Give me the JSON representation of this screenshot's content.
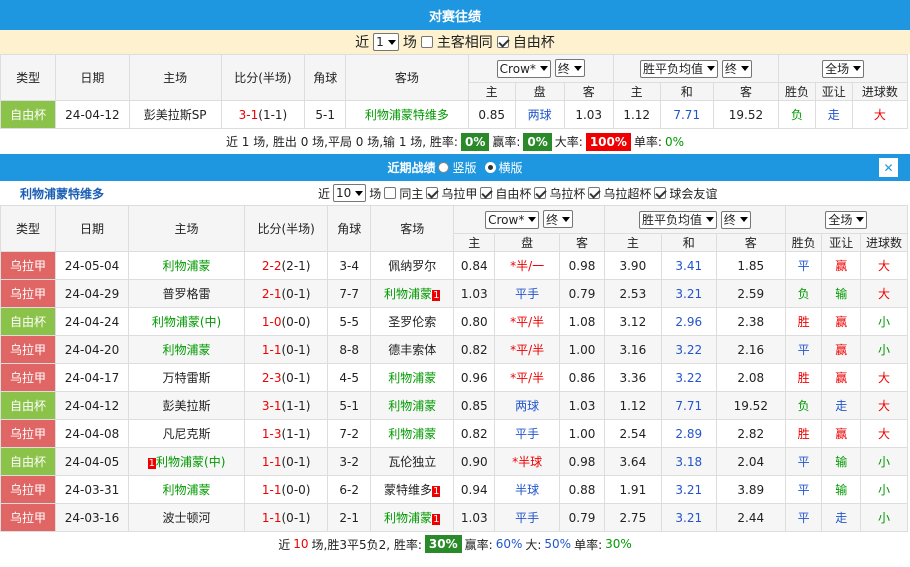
{
  "h2h": {
    "title": "对赛往绩",
    "near_label": "近",
    "count_value": "1",
    "unit": "场",
    "same_home": "主客相同",
    "cup_label": "自由杯",
    "headers": [
      "类型",
      "日期",
      "主场",
      "比分(半场)",
      "角球",
      "客场"
    ],
    "crow": "Crow*",
    "end": "终",
    "odds_avg": "胜平负均值",
    "full": "全场",
    "sub_headers": [
      "主",
      "盘",
      "客",
      "主",
      "和",
      "客"
    ],
    "right_headers": [
      "胜负",
      "亚让",
      "进球数"
    ],
    "rows": [
      {
        "type": "自由杯",
        "type_color": "#8bc34a",
        "date": "24-04-12",
        "home": "彭美拉斯SP",
        "score": "3-1",
        "half": "(1-1)",
        "corner": "5-1",
        "away": "利物浦蒙特维多",
        "o1": "0.85",
        "o2": "两球",
        "o3": "1.03",
        "e1": "1.12",
        "e2": "7.71",
        "e3": "19.52",
        "r1": "负",
        "r2": "走",
        "r3": "大"
      }
    ],
    "summary": {
      "text": "近 1 场, 胜出 0 场,平局 0 场,输 1 场, 胜率:",
      "win": "0%",
      "win_label": "赢率:",
      "win_rate": "0%",
      "big_label": "大率:",
      "big_rate": "100%",
      "single_label": "单率:",
      "single_rate": "0%"
    }
  },
  "recent": {
    "title": "近期战绩",
    "vert": "竖版",
    "horiz": "横版",
    "close": "✕",
    "team": "利物浦蒙特维多",
    "near_label": "近",
    "count_value": "10",
    "unit": "场",
    "filters": [
      "同主",
      "乌拉甲",
      "自由杯",
      "乌拉杯",
      "乌拉超杯",
      "球会友谊"
    ],
    "headers": [
      "类型",
      "日期",
      "主场",
      "比分(半场)",
      "角球",
      "客场"
    ],
    "crow": "Crow*",
    "end": "终",
    "odds_avg": "胜平负均值",
    "full": "全场",
    "sub_headers": [
      "主",
      "盘",
      "客",
      "主",
      "和",
      "客"
    ],
    "right_headers": [
      "胜负",
      "亚让",
      "进球数"
    ],
    "rows": [
      {
        "type": "乌拉甲",
        "c": "#e06666",
        "date": "24-05-04",
        "home": "利物浦蒙",
        "hg": true,
        "score": "2-2",
        "half": "(2-1)",
        "corner": "3-4",
        "away": "佩纳罗尔",
        "ag": false,
        "o1": "0.84",
        "o2": "*半/一",
        "o2r": true,
        "o3": "0.98",
        "e1": "3.90",
        "e2": "3.41",
        "e3": "1.85",
        "r1": "平",
        "r1c": "blue",
        "r2": "赢",
        "r2c": "red",
        "r3": "大",
        "r3c": "red"
      },
      {
        "type": "乌拉甲",
        "c": "#e06666",
        "date": "24-04-29",
        "home": "普罗格雷",
        "hg": false,
        "score": "2-1",
        "half": "(0-1)",
        "corner": "7-7",
        "away": "利物浦蒙",
        "ag": true,
        "aflag": "1",
        "o1": "1.03",
        "o2": "平手",
        "o2r": false,
        "o3": "0.79",
        "e1": "2.53",
        "e2": "3.21",
        "e3": "2.59",
        "r1": "负",
        "r1c": "green",
        "r2": "输",
        "r2c": "green",
        "r3": "大",
        "r3c": "red"
      },
      {
        "type": "自由杯",
        "c": "#8bc34a",
        "date": "24-04-24",
        "home": "利物浦蒙(中)",
        "hg": true,
        "score": "1-0",
        "half": "(0-0)",
        "corner": "5-5",
        "away": "圣罗伦索",
        "ag": false,
        "o1": "0.80",
        "o2": "*平/半",
        "o2r": true,
        "o3": "1.08",
        "e1": "3.12",
        "e2": "2.96",
        "e3": "2.38",
        "r1": "胜",
        "r1c": "red",
        "r2": "赢",
        "r2c": "red",
        "r3": "小",
        "r3c": "green"
      },
      {
        "type": "乌拉甲",
        "c": "#e06666",
        "date": "24-04-20",
        "home": "利物浦蒙",
        "hg": true,
        "score": "1-1",
        "half": "(0-1)",
        "corner": "8-8",
        "away": "德丰索体",
        "ag": false,
        "o1": "0.82",
        "o2": "*平/半",
        "o2r": true,
        "o3": "1.00",
        "e1": "3.16",
        "e2": "3.22",
        "e3": "2.16",
        "r1": "平",
        "r1c": "blue",
        "r2": "赢",
        "r2c": "red",
        "r3": "小",
        "r3c": "green"
      },
      {
        "type": "乌拉甲",
        "c": "#e06666",
        "date": "24-04-17",
        "home": "万特雷斯",
        "hg": false,
        "score": "2-3",
        "half": "(0-1)",
        "corner": "4-5",
        "away": "利物浦蒙",
        "ag": true,
        "o1": "0.96",
        "o2": "*平/半",
        "o2r": true,
        "o3": "0.86",
        "e1": "3.36",
        "e2": "3.22",
        "e3": "2.08",
        "r1": "胜",
        "r1c": "red",
        "r2": "赢",
        "r2c": "red",
        "r3": "大",
        "r3c": "red"
      },
      {
        "type": "自由杯",
        "c": "#8bc34a",
        "date": "24-04-12",
        "home": "彭美拉斯",
        "hg": false,
        "score": "3-1",
        "half": "(1-1)",
        "corner": "5-1",
        "away": "利物浦蒙",
        "ag": true,
        "o1": "0.85",
        "o2": "两球",
        "o2r": false,
        "o3": "1.03",
        "e1": "1.12",
        "e2": "7.71",
        "e3": "19.52",
        "r1": "负",
        "r1c": "green",
        "r2": "走",
        "r2c": "blue",
        "r3": "大",
        "r3c": "red"
      },
      {
        "type": "乌拉甲",
        "c": "#e06666",
        "date": "24-04-08",
        "home": "凡尼克斯",
        "hg": false,
        "score": "1-3",
        "half": "(1-1)",
        "corner": "7-2",
        "away": "利物浦蒙",
        "ag": true,
        "o1": "0.82",
        "o2": "平手",
        "o2r": false,
        "o3": "1.00",
        "e1": "2.54",
        "e2": "2.89",
        "e3": "2.82",
        "r1": "胜",
        "r1c": "red",
        "r2": "赢",
        "r2c": "red",
        "r3": "大",
        "r3c": "red"
      },
      {
        "type": "自由杯",
        "c": "#8bc34a",
        "date": "24-04-05",
        "home": "利物浦蒙(中)",
        "hg": true,
        "hflag": "1",
        "score": "1-1",
        "half": "(0-1)",
        "corner": "3-2",
        "away": "瓦伦独立",
        "ag": false,
        "o1": "0.90",
        "o2": "*半球",
        "o2r": true,
        "o3": "0.98",
        "e1": "3.64",
        "e2": "3.18",
        "e3": "2.04",
        "r1": "平",
        "r1c": "blue",
        "r2": "输",
        "r2c": "green",
        "r3": "小",
        "r3c": "green"
      },
      {
        "type": "乌拉甲",
        "c": "#e06666",
        "date": "24-03-31",
        "home": "利物浦蒙",
        "hg": true,
        "score": "1-1",
        "half": "(0-0)",
        "corner": "6-2",
        "away": "蒙特维多",
        "ag": false,
        "aflag": "1",
        "o1": "0.94",
        "o2": "半球",
        "o2r": false,
        "o3": "0.88",
        "e1": "1.91",
        "e2": "3.21",
        "e3": "3.89",
        "r1": "平",
        "r1c": "blue",
        "r2": "输",
        "r2c": "green",
        "r3": "小",
        "r3c": "green"
      },
      {
        "type": "乌拉甲",
        "c": "#e06666",
        "date": "24-03-16",
        "home": "波士顿河",
        "hg": false,
        "score": "1-1",
        "half": "(0-1)",
        "corner": "2-1",
        "away": "利物浦蒙",
        "ag": true,
        "aflag": "1",
        "o1": "1.03",
        "o2": "平手",
        "o2r": false,
        "o3": "0.79",
        "e1": "2.75",
        "e2": "3.21",
        "e3": "2.44",
        "r1": "平",
        "r1c": "blue",
        "r2": "走",
        "r2c": "blue",
        "r3": "小",
        "r3c": "green"
      }
    ],
    "summary": {
      "pre": "近",
      "count": "10",
      "mid": "场,胜3平5负2, 胜率:",
      "win": "30%",
      "win_label": "赢率:",
      "win_rate": "60%",
      "big_label": "大:",
      "big_rate": "50%",
      "single_label": "单率:",
      "single_rate": "30%"
    }
  }
}
